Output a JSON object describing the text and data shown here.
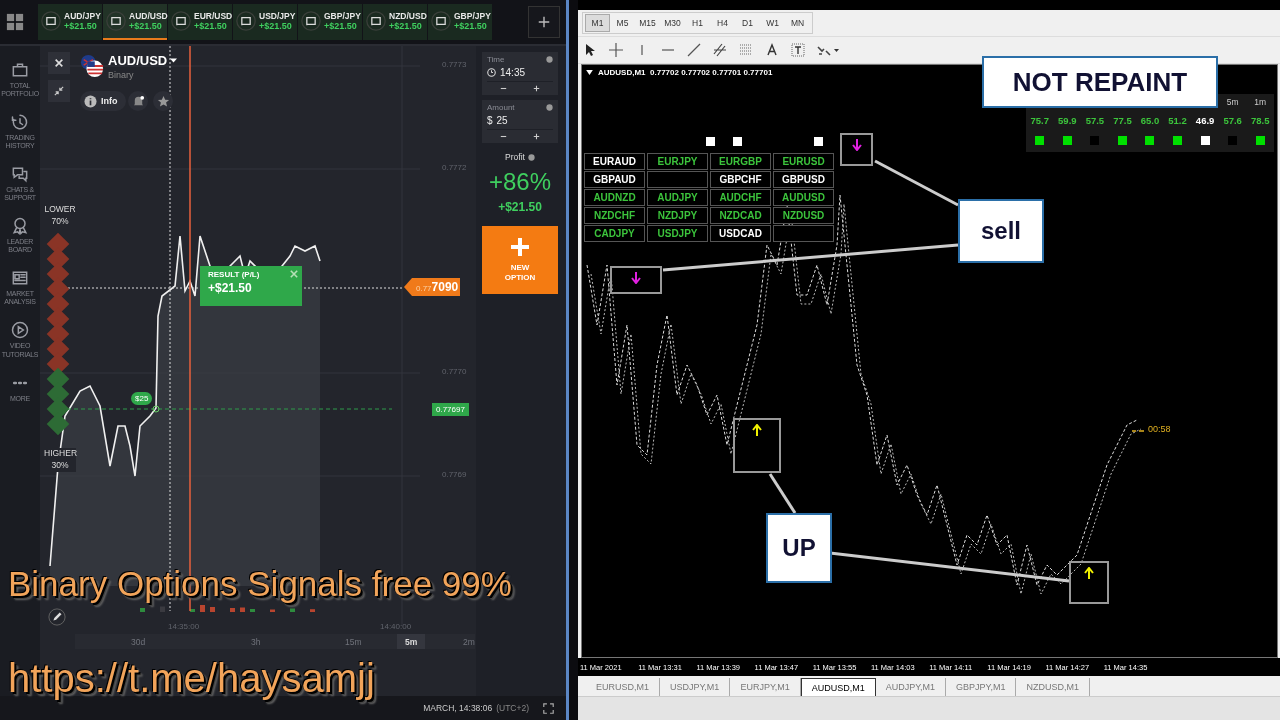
{
  "trading_app": {
    "asset_tabs": [
      {
        "name": "AUD/JPY",
        "profit": "+$21.50",
        "selected": false
      },
      {
        "name": "AUD/USD",
        "profit": "+$21.50",
        "selected": true
      },
      {
        "name": "EUR/USD",
        "profit": "+$21.50",
        "selected": false
      },
      {
        "name": "USD/JPY",
        "profit": "+$21.50",
        "selected": false
      },
      {
        "name": "GBP/JPY",
        "profit": "+$21.50",
        "selected": false
      },
      {
        "name": "NZD/USD",
        "profit": "+$21.50",
        "selected": false
      },
      {
        "name": "GBP/JPY",
        "profit": "+$21.50",
        "selected": false
      }
    ],
    "sidebar": [
      {
        "label": "TOTAL PORTFOLIO"
      },
      {
        "label": "TRADING HISTORY"
      },
      {
        "label": "CHATS & SUPPORT"
      },
      {
        "label": "LEADER BOARD"
      },
      {
        "label": "MARKET ANALYSIS"
      },
      {
        "label": "VIDEO TUTORIALS"
      },
      {
        "label": "MORE"
      }
    ],
    "asset": {
      "name": "AUD/USD",
      "type": "Binary",
      "info": "Info"
    },
    "price_levels": [
      "0.7773",
      "0.7772",
      "0.7770",
      "0.7769"
    ],
    "lower": {
      "label": "LOWER",
      "percent": "70%"
    },
    "higher": {
      "label": "HIGHER",
      "percent": "30%"
    },
    "result": {
      "label": "RESULT (P/L)",
      "value": "+$21.50"
    },
    "current_price": {
      "prefix": "0.77",
      "suffix": "7090"
    },
    "stake_tag": "$25",
    "strike_price": "0.77697",
    "time_axis": [
      "14:35:00",
      "14:40:00"
    ],
    "timeframes": [
      {
        "label": "30d",
        "selected": false
      },
      {
        "label": "3h",
        "selected": false
      },
      {
        "label": "15m",
        "selected": false
      },
      {
        "label": "5m",
        "selected": true
      },
      {
        "label": "2m",
        "selected": false
      }
    ],
    "clock": "MARCH, 14:38:06",
    "timezone": "(UTC+2)",
    "time": {
      "label": "Time",
      "value": "14:35"
    },
    "amount": {
      "label": "Amount",
      "currency": "$",
      "value": "25"
    },
    "profit": {
      "label": "Profit",
      "percent": "+86%",
      "value": "+$21.50"
    },
    "new_option": "NEW OPTION"
  },
  "metatrader": {
    "timeframes": [
      {
        "label": "M1",
        "selected": true
      },
      {
        "label": "M5",
        "selected": false
      },
      {
        "label": "M15",
        "selected": false
      },
      {
        "label": "M30",
        "selected": false
      },
      {
        "label": "H1",
        "selected": false
      },
      {
        "label": "H4",
        "selected": false
      },
      {
        "label": "D1",
        "selected": false
      },
      {
        "label": "W1",
        "selected": false
      },
      {
        "label": "MN",
        "selected": false
      }
    ],
    "chart_title": "AUDUSD,M1  0.77702 0.77702 0.77701 0.77701",
    "pairs": [
      {
        "kind": "pair",
        "label": "EURAUD",
        "active": false
      },
      {
        "kind": "pair",
        "label": "EURJPY",
        "active": true
      },
      {
        "kind": "pair",
        "label": "EURGBP",
        "active": true
      },
      {
        "kind": "pair",
        "label": "EURUSD",
        "active": true
      },
      {
        "kind": "pair",
        "label": "GBPAUD",
        "active": false
      },
      {
        "kind": "empty"
      },
      {
        "kind": "pair",
        "label": "GBPCHF",
        "active": false
      },
      {
        "kind": "pair",
        "label": "GBPUSD",
        "active": false
      },
      {
        "kind": "pair",
        "label": "AUDNZD",
        "active": true
      },
      {
        "kind": "pair",
        "label": "AUDJPY",
        "active": true
      },
      {
        "kind": "pair",
        "label": "AUDCHF",
        "active": true
      },
      {
        "kind": "pair",
        "label": "AUDUSD",
        "active": true
      },
      {
        "kind": "pair",
        "label": "NZDCHF",
        "active": true
      },
      {
        "kind": "pair",
        "label": "NZDJPY",
        "active": true
      },
      {
        "kind": "pair",
        "label": "NZDCAD",
        "active": true
      },
      {
        "kind": "pair",
        "label": "NZDUSD",
        "active": true
      },
      {
        "kind": "pair",
        "label": "CADJPY",
        "active": true
      },
      {
        "kind": "pair",
        "label": "USDJPY",
        "active": true
      },
      {
        "kind": "pair",
        "label": "USDCAD",
        "active": false
      },
      {
        "kind": "empty"
      }
    ],
    "signal_panel": {
      "headers": [
        "5m",
        "1m"
      ],
      "values": [
        {
          "value": "75.7",
          "color": "#3cc43c"
        },
        {
          "value": "59.9",
          "color": "#3cc43c"
        },
        {
          "value": "57.5",
          "color": "#3cc43c"
        },
        {
          "value": "77.5",
          "color": "#3cc43c"
        },
        {
          "value": "65.0",
          "color": "#3cc43c"
        },
        {
          "value": "51.2",
          "color": "#3cc43c"
        },
        {
          "value": "46.9",
          "color": "#ffffff"
        },
        {
          "value": "57.6",
          "color": "#3cc43c"
        },
        {
          "value": "78.5",
          "color": "#3cc43c"
        }
      ],
      "squares": [
        {
          "color": "#00e000"
        },
        {
          "color": "#00e000"
        },
        {
          "color": "#000000"
        },
        {
          "color": "#00e000"
        },
        {
          "color": "#00e000"
        },
        {
          "color": "#00e000"
        },
        {
          "color": "#ffffff"
        },
        {
          "color": "#000000"
        },
        {
          "color": "#00e000"
        }
      ]
    },
    "callouts": [
      "NOT REPAINT",
      "sell",
      "UP"
    ],
    "countdown": "00:58",
    "time_axis": [
      "11 Mar 2021",
      "11 Mar 13:31",
      "11 Mar 13:39",
      "11 Mar 13:47",
      "11 Mar 13:55",
      "11 Mar 14:03",
      "11 Mar 14:11",
      "11 Mar 14:19",
      "11 Mar 14:27",
      "11 Mar 14:35"
    ],
    "chart_tabs": [
      {
        "label": "EURUSD,M1",
        "selected": false
      },
      {
        "label": "USDJPY,M1",
        "selected": false
      },
      {
        "label": "EURJPY,M1",
        "selected": false
      },
      {
        "label": "AUDUSD,M1",
        "selected": true
      },
      {
        "label": "AUDJPY,M1",
        "selected": false
      },
      {
        "label": "GBPJPY,M1",
        "selected": false
      },
      {
        "label": "NZDUSD,M1",
        "selected": false
      }
    ]
  },
  "caption": {
    "headline": "Binary Options Signals free 99%",
    "link": "https://t.me/haysamjj"
  }
}
